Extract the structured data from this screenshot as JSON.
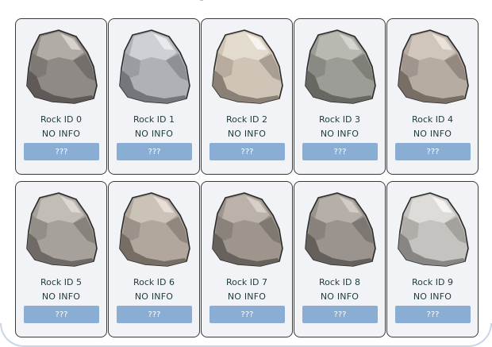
{
  "rocks": [
    {
      "id_label": "Rock ID 0",
      "info": "NO INFO",
      "button_label": "???",
      "colors": {
        "base": "#8f8a86",
        "light": "#b2aca6",
        "dark": "#5f5a57",
        "highlight": "#d7d2cc"
      }
    },
    {
      "id_label": "Rock ID 1",
      "info": "NO INFO",
      "button_label": "???",
      "colors": {
        "base": "#aeb1b6",
        "light": "#cdd0d4",
        "dark": "#73767b",
        "highlight": "#e8eaec"
      }
    },
    {
      "id_label": "Rock ID 2",
      "info": "NO INFO",
      "button_label": "???",
      "colors": {
        "base": "#cfc4b6",
        "light": "#e4dbcf",
        "dark": "#8b8075",
        "highlight": "#f7f3ee"
      }
    },
    {
      "id_label": "Rock ID 3",
      "info": "NO INFO",
      "button_label": "???",
      "colors": {
        "base": "#9c9d96",
        "light": "#b8b9b1",
        "dark": "#676861",
        "highlight": "#d5d6d0"
      }
    },
    {
      "id_label": "Rock ID 4",
      "info": "NO INFO",
      "button_label": "???",
      "colors": {
        "base": "#b7aca2",
        "light": "#d0c6bc",
        "dark": "#786e66",
        "highlight": "#e9e3dc"
      }
    },
    {
      "id_label": "Rock ID 5",
      "info": "NO INFO",
      "button_label": "???",
      "colors": {
        "base": "#a7a19b",
        "light": "#c3bdb7",
        "dark": "#6f6a65",
        "highlight": "#ddd8d3"
      }
    },
    {
      "id_label": "Rock ID 6",
      "info": "NO INFO",
      "button_label": "???",
      "colors": {
        "base": "#b1a79d",
        "light": "#cbc2b8",
        "dark": "#766d65",
        "highlight": "#e6dfd8"
      }
    },
    {
      "id_label": "Rock ID 7",
      "info": "NO INFO",
      "button_label": "???",
      "colors": {
        "base": "#9e968d",
        "light": "#bbb3aa",
        "dark": "#68625c",
        "highlight": "#d6d0c9"
      }
    },
    {
      "id_label": "Rock ID 8",
      "info": "NO INFO",
      "button_label": "???",
      "colors": {
        "base": "#9a938e",
        "light": "#b6afa9",
        "dark": "#66605c",
        "highlight": "#d2ccc7"
      }
    },
    {
      "id_label": "Rock ID 9",
      "info": "NO INFO",
      "button_label": "???",
      "colors": {
        "base": "#c5c3bf",
        "light": "#dedcd8",
        "dark": "#888682",
        "highlight": "#f5f4f2"
      }
    }
  ],
  "theme": {
    "card_background": "#f2f3f6",
    "card_border": "#3a3a3a",
    "button_color": "#8aaed3",
    "text_color": "#1d3b3b"
  }
}
